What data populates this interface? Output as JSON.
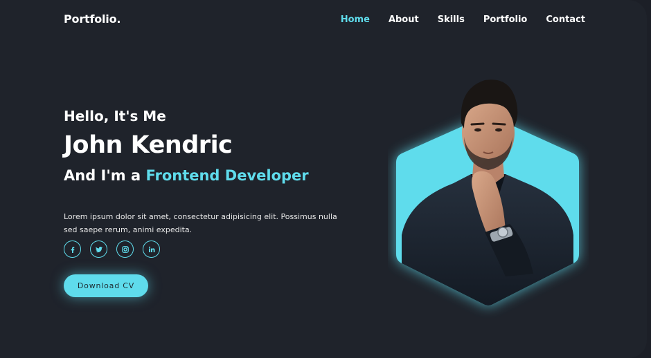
{
  "header": {
    "logo": "Portfolio.",
    "nav": [
      {
        "label": "Home",
        "active": true
      },
      {
        "label": "About",
        "active": false
      },
      {
        "label": "Skills",
        "active": false
      },
      {
        "label": "Portfolio",
        "active": false
      },
      {
        "label": "Contact",
        "active": false
      }
    ]
  },
  "hero": {
    "greeting": "Hello, It's Me",
    "name": "John Kendric",
    "role_prefix": "And I'm a ",
    "role_highlight": "Frontend Developer",
    "description": "Lorem ipsum dolor sit amet, consectetur adipisicing elit. Possimus nulla sed saepe rerum, animi expedita.",
    "cv_button": "Download CV",
    "socials": [
      "facebook-icon",
      "twitter-icon",
      "instagram-icon",
      "linkedin-icon"
    ]
  },
  "colors": {
    "accent": "#5fdcec",
    "background": "#1f232b",
    "text": "#ffffff"
  }
}
